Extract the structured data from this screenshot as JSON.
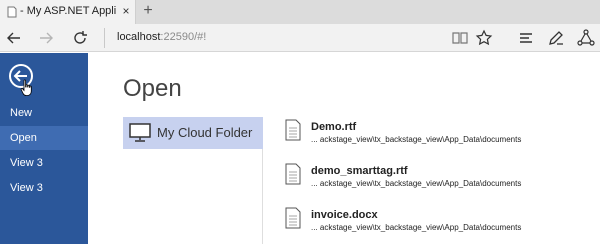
{
  "browser": {
    "tab_title": "- My ASP.NET Applicatio",
    "tab_close": "×",
    "new_tab": "+",
    "url_host": "localhost",
    "url_rest": ":22590/#!"
  },
  "sidebar": {
    "items": [
      {
        "label": "New"
      },
      {
        "label": "Open"
      },
      {
        "label": "View 3"
      },
      {
        "label": "View 3"
      }
    ],
    "active_index": 1
  },
  "main": {
    "heading": "Open",
    "places": [
      {
        "label": "My Cloud Folder",
        "icon": "computer-icon"
      }
    ],
    "files": [
      {
        "name": "Demo.rtf",
        "path": "... ackstage_view\\tx_backstage_view\\App_Data\\documents"
      },
      {
        "name": "demo_smarttag.rtf",
        "path": "... ackstage_view\\tx_backstage_view\\App_Data\\documents"
      },
      {
        "name": "invoice.docx",
        "path": "... ackstage_view\\tx_backstage_view\\App_Data\\documents"
      }
    ]
  },
  "colors": {
    "sidebar_bg": "#2b579a",
    "sidebar_active": "#3f6cb2",
    "place_selected": "#c7d1ef"
  }
}
